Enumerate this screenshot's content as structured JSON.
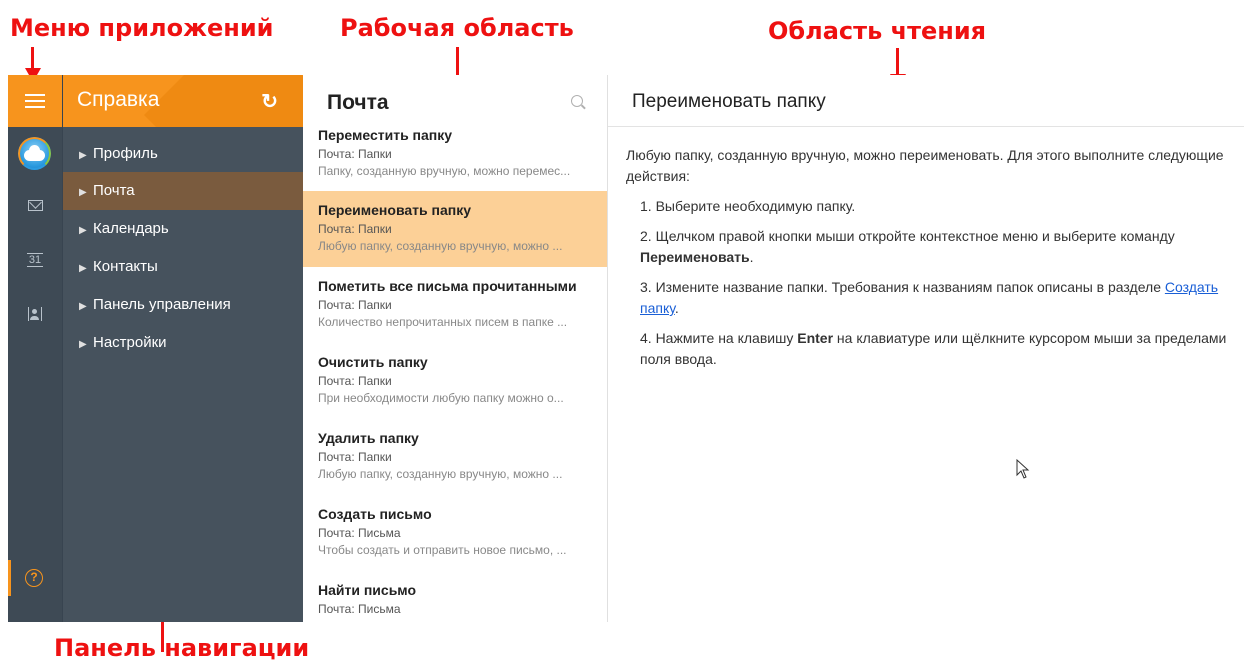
{
  "callouts": {
    "apps_menu": "Меню приложений",
    "work_area": "Рабочая область",
    "reading_area": "Область чтения",
    "nav_panel": "Панель навигации"
  },
  "header": {
    "app_title": "Справка",
    "work_title": "Почта"
  },
  "rail": {
    "calendar_day": "31",
    "help_glyph": "?"
  },
  "nav": {
    "items": [
      {
        "label": "Профиль"
      },
      {
        "label": "Почта"
      },
      {
        "label": "Календарь"
      },
      {
        "label": "Контакты"
      },
      {
        "label": "Панель управления"
      },
      {
        "label": "Настройки"
      }
    ]
  },
  "list": {
    "items": [
      {
        "title": "Переместить папку",
        "section": "Почта: Папки",
        "snippet": "Папку, созданную вручную, можно перемес..."
      },
      {
        "title": "Переименовать папку",
        "section": "Почта: Папки",
        "snippet": "Любую папку, созданную вручную, можно ..."
      },
      {
        "title": "Пометить все письма прочитанными",
        "section": "Почта: Папки",
        "snippet": "Количество непрочитанных писем в папке ..."
      },
      {
        "title": "Очистить папку",
        "section": "Почта: Папки",
        "snippet": "При необходимости любую папку можно о..."
      },
      {
        "title": "Удалить папку",
        "section": "Почта: Папки",
        "snippet": "Любую папку, созданную вручную, можно ..."
      },
      {
        "title": "Создать письмо",
        "section": "Почта: Письма",
        "snippet": "Чтобы создать и отправить новое письмо, ..."
      },
      {
        "title": "Найти письмо",
        "section": "Почта: Письма",
        "snippet": ""
      }
    ]
  },
  "reader": {
    "title": "Переименовать папку",
    "intro": "Любую папку, созданную вручную, можно переименовать. Для этого выполните следующие действия:",
    "step1": "1.  Выберите необходимую папку.",
    "step2_text": "2.  Щелчком правой кнопки мыши откройте контекстное меню и выберите команду",
    "step2_bold": "Переименовать",
    "step2_end": ".",
    "step3_text": "3.  Измените название папки. Требования к названиям папок описаны в разделе",
    "step3_link": "Создать папку",
    "step3_end": ".",
    "step4_a": "4.  Нажмите на клавишу",
    "step4_bold": "Enter",
    "step4_b": "на клавиатуре или щёлкните курсором мыши за пределами поля ввода."
  },
  "colors": {
    "accent": "#f7941d",
    "selected_row": "#fcd097",
    "nav_bg": "#46525d",
    "callout": "#ee1111"
  }
}
